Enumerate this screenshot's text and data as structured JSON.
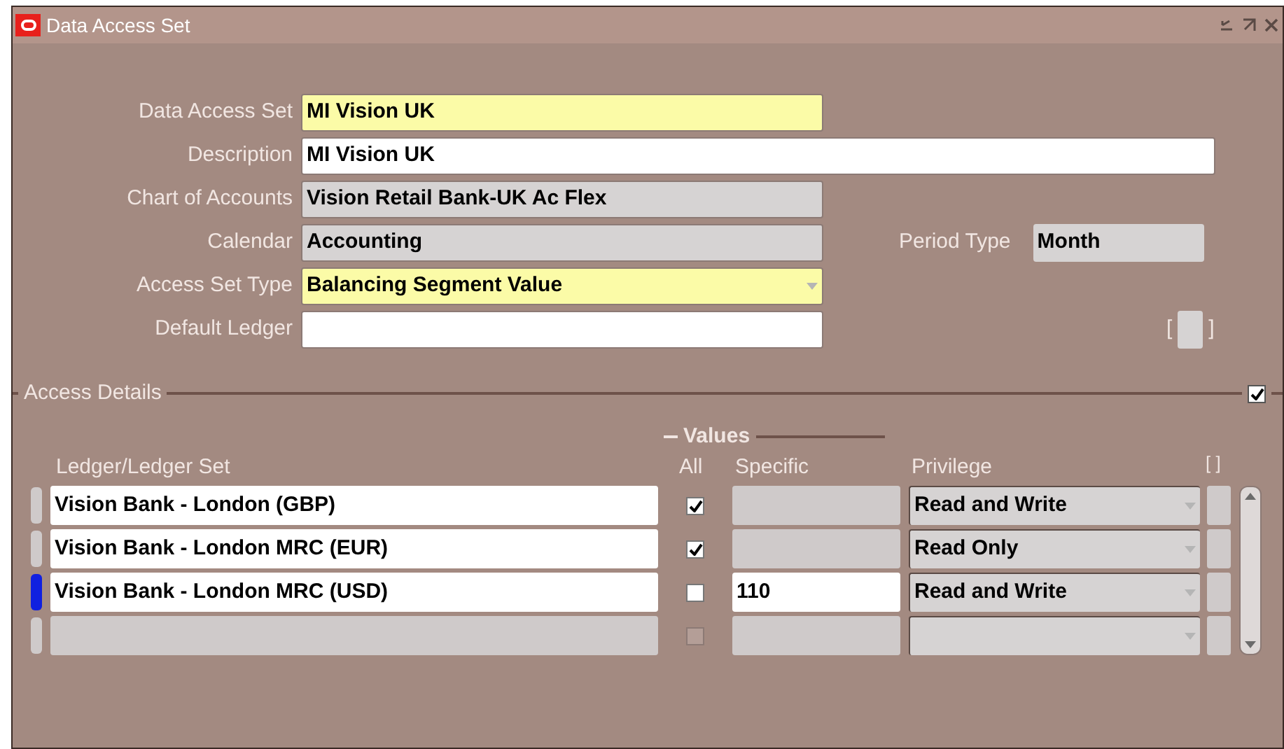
{
  "window": {
    "title": "Data Access Set"
  },
  "header_fields": [
    {
      "label": "Data Access Set",
      "value": "MI Vision UK",
      "kind": "required",
      "wide": false,
      "dropdown": false
    },
    {
      "label": "Description",
      "value": "MI Vision UK",
      "kind": "editable",
      "wide": true,
      "dropdown": false
    },
    {
      "label": "Chart of Accounts",
      "value": "Vision Retail Bank-UK Ac Flex",
      "kind": "readonly",
      "wide": false,
      "dropdown": false
    },
    {
      "label": "Calendar",
      "value": "Accounting",
      "kind": "readonly",
      "wide": false,
      "dropdown": false,
      "side": {
        "label": "Period Type",
        "value": "Month"
      }
    },
    {
      "label": "Access Set Type",
      "value": "Balancing Segment Value",
      "kind": "required",
      "wide": false,
      "dropdown": true
    },
    {
      "label": "Default Ledger",
      "kind": "editable",
      "wide": false,
      "dropdown": false
    }
  ],
  "flexfield": {
    "open": "[",
    "close": "]"
  },
  "access_details": {
    "title": "Access Details",
    "checked": true,
    "values_group": "Values",
    "columns": [
      "Ledger/Ledger Set",
      "All",
      "Specific",
      "Privilege"
    ],
    "flexfield_label": "[ ]",
    "rows": [
      {
        "ledger": "Vision Bank - London (GBP)",
        "all": true,
        "privilege": "Read and Write",
        "current": false,
        "disabled": false
      },
      {
        "ledger": "Vision Bank - London MRC (EUR)",
        "all": true,
        "privilege": "Read Only",
        "current": false,
        "disabled": false
      },
      {
        "ledger": "Vision Bank - London MRC (USD)",
        "all": false,
        "specific": "110",
        "privilege": "Read and Write",
        "current": true,
        "disabled": false
      },
      {
        "all": false,
        "current": false,
        "disabled": true
      }
    ]
  }
}
